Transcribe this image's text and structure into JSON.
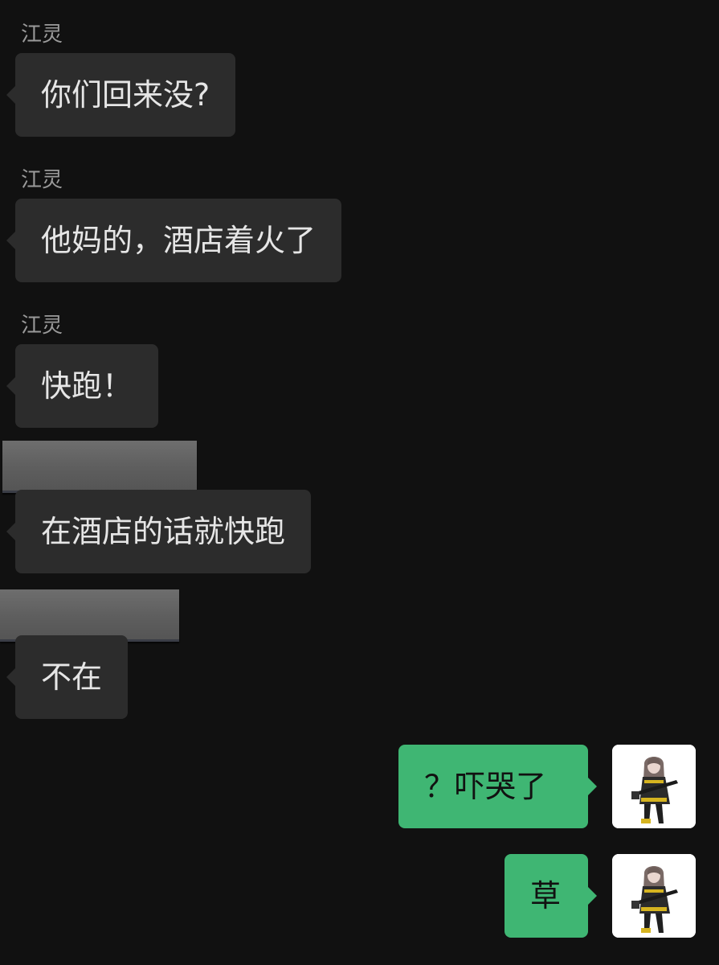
{
  "conversation": {
    "messages": [
      {
        "sender": "江灵",
        "text": "你们回来没?"
      },
      {
        "sender": "江灵",
        "text": "他妈的，酒店着火了"
      },
      {
        "sender": "江灵",
        "text": "快跑！"
      },
      {
        "sender": "",
        "text": "在酒店的话就快跑"
      },
      {
        "sender": "",
        "text": "不在"
      }
    ],
    "outgoing": [
      {
        "text": "？吓哭了"
      },
      {
        "text": "草"
      }
    ]
  },
  "colors": {
    "background": "#111111",
    "incoming_bubble": "#2c2c2c",
    "outgoing_bubble": "#3fb673",
    "sender_name": "#9a9a9a"
  },
  "icons": {
    "avatar": "anime-girl-avatar-icon"
  }
}
